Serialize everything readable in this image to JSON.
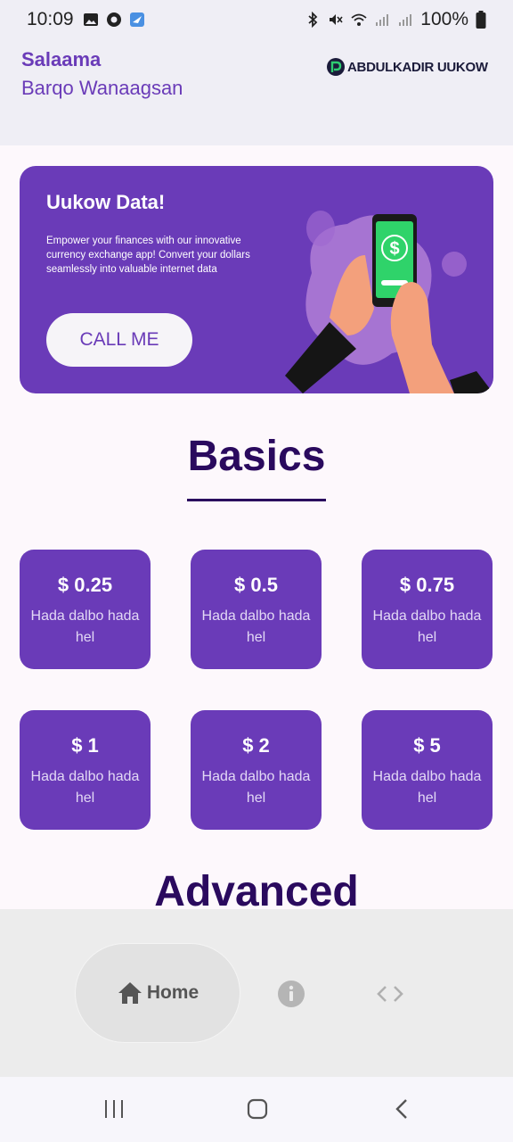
{
  "status_bar": {
    "time": "10:09",
    "battery": "100%"
  },
  "header": {
    "greeting": "Salaama",
    "subtitle": "Barqo Wanaagsan",
    "logo_text": "ABDULKADIR UUKOW"
  },
  "banner": {
    "title": "Uukow Data!",
    "description": "Empower your finances with our innovative currency exchange app! Convert your dollars seamlessly into valuable internet data",
    "button_label": "CALL ME"
  },
  "sections": {
    "basics": "Basics",
    "advanced": "Advanced"
  },
  "cards": [
    {
      "price": "$ 0.25",
      "desc": "Hada dalbo hada hel"
    },
    {
      "price": "$ 0.5",
      "desc": "Hada dalbo hada hel"
    },
    {
      "price": "$ 0.75",
      "desc": "Hada dalbo hada hel"
    },
    {
      "price": "$ 1",
      "desc": "Hada dalbo hada hel"
    },
    {
      "price": "$ 2",
      "desc": "Hada dalbo hada hel"
    },
    {
      "price": "$ 5",
      "desc": "Hada dalbo hada hel"
    }
  ],
  "bottom_nav": {
    "home_label": "Home",
    "icons": [
      "home-icon",
      "info-icon",
      "code-icon"
    ]
  },
  "colors": {
    "primary": "#6a3bb8",
    "dark_text": "#2a0a5e",
    "header_bg": "#efeef5"
  }
}
